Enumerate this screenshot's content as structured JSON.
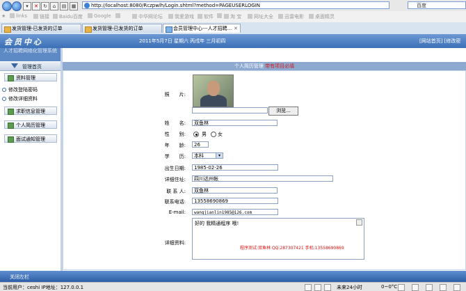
{
  "browser": {
    "url": "http://localhost:8080/Rczpwlh/Login.shtml?method=PAGEUSERLOGIN",
    "search_placeholder": "百度",
    "favorites": [
      "links",
      "链接",
      "Baidu百度",
      "Google",
      "",
      "中华网论坛",
      "我爱游戏",
      "软件",
      "",
      "淘 宝",
      "网址大全",
      "迅雷电影",
      "桌面精灵"
    ],
    "tabs": [
      {
        "label": "发货管理-已发货的订单",
        "active": false
      },
      {
        "label": "发货管理-已发货的订单",
        "active": false
      },
      {
        "label": "会员管理中心---人才招聘...",
        "active": true
      }
    ]
  },
  "header": {
    "logo": "会员中心",
    "date": "2011年5月7日  星期六  丙戌年  三月初四",
    "right_links": "[网站首页] [修改密"
  },
  "sidebar": {
    "site_name": "人才招聘网络化管理系统",
    "home": "管理首页",
    "items": [
      {
        "label": "资料管理",
        "type": "menu"
      },
      {
        "label": "修改登陆密码",
        "type": "sub"
      },
      {
        "label": "修改详细资料",
        "type": "sub"
      },
      {
        "label": "求职信息管理",
        "type": "menu"
      },
      {
        "label": "个人简历管理",
        "type": "menu"
      },
      {
        "label": "面试通知管理",
        "type": "menu"
      }
    ]
  },
  "form": {
    "title": "个人简历管理",
    "required_note": "带有项目必填",
    "browse_label": "浏览...",
    "fields": {
      "photo": {
        "label": "照　　片:"
      },
      "name": {
        "label": "姓　　名:",
        "value": "双鱼林"
      },
      "gender": {
        "label": "性　　别:",
        "options": [
          "男",
          "女"
        ],
        "selected": "男"
      },
      "age": {
        "label": "年　　龄:",
        "value": "26"
      },
      "education": {
        "label": "学　　历:",
        "value": "本科"
      },
      "birthday": {
        "label": "出生日期:",
        "value": "1985-02-26"
      },
      "address": {
        "label": "详细住址:",
        "value": "四川达州帐"
      },
      "contact": {
        "label": "联 系 人:",
        "value": "双鱼林"
      },
      "phone": {
        "label": "联系电话:",
        "value": "13558690869"
      },
      "email": {
        "label": "E-mail:",
        "value": "wangjianlin1985@126.com"
      },
      "details": {
        "label": "详细资料:",
        "value": "好的 我精通程序 哦!",
        "signature": "程序测试:双鱼林 QQ:287307421 手机:13558690869"
      }
    }
  },
  "footer": {
    "label": "关闭左栏"
  },
  "status": {
    "user": "当前用户：ceshi  IP地址：127.0.0.1",
    "weather": "未来24小时",
    "temp": "0~0°C"
  },
  "colors": {
    "header": "#3b6fb7",
    "accent": "#d21f1f"
  }
}
